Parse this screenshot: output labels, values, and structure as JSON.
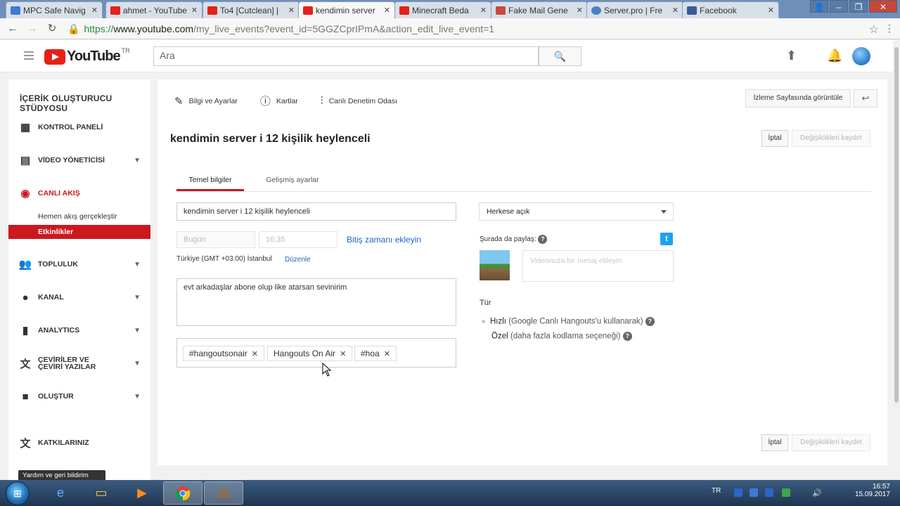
{
  "browser": {
    "tabs": [
      {
        "title": "MPC Safe Navig",
        "color": "#3b7bd4"
      },
      {
        "title": "ahmet - YouTube",
        "color": "#e62117"
      },
      {
        "title": "To4 [Cutclean] |",
        "color": "#e62117"
      },
      {
        "title": "kendimin server",
        "color": "#e62117"
      },
      {
        "title": "Minecraft Beda",
        "color": "#e62117"
      },
      {
        "title": "Fake Mail Gene",
        "color": "#c84a3a"
      },
      {
        "title": "Server.pro | Fre",
        "color": "#4a7fc4"
      },
      {
        "title": "Facebook",
        "color": "#3b5998"
      }
    ],
    "active_tab": 3,
    "url_https": "https://",
    "url_host": "www.youtube.com",
    "url_path": "/my_live_events?event_id=5GGZCprIPmA&action_edit_live_event=1"
  },
  "yt": {
    "logo_text": "YouTube",
    "country": "TR",
    "search_placeholder": "Ara"
  },
  "sidebar": {
    "title": "İÇERİK OLUŞTURUCU STÜDYOSU",
    "items": {
      "dashboard": "KONTROL PANELİ",
      "video_manager": "VİDEO YÖNETİCİSİ",
      "live": "CANLI AKIŞ",
      "live_now": "Hemen akış gerçekleştir",
      "events": "Etkinlikler",
      "community": "TOPLULUK",
      "channel": "KANAL",
      "analytics": "ANALYTICS",
      "translations": "ÇEVİRİLER VE ÇEVİRİ YAZILAR",
      "create": "OLUŞTUR",
      "contributions": "KATKILARINIZ"
    },
    "tooltip": "Yardım ve geri bildirim"
  },
  "main": {
    "toptabs": {
      "info": "Bilgi ve Ayarlar",
      "cards": "Kartlar",
      "control_room": "Canlı Denetim Odası"
    },
    "watch_button": "İzleme Sayfasında görüntüle",
    "event_title": "kendimin server i 12 kişilik heylenceli",
    "cancel": "İptal",
    "save": "Değişiklikleri kaydet",
    "subtabs": {
      "basic": "Temel bilgiler",
      "advanced": "Gelişmiş ayarlar"
    },
    "form": {
      "title_value": "kendimin server i 12 kişilik heylenceli",
      "date_value": "Bugün",
      "time_value": "16:35",
      "add_end_time": "Bitiş zamanı ekleyin",
      "timezone": "Türkiye (GMT +03:00) İstanbul",
      "edit": "Düzenle",
      "description": "evt arkadaşlar  abone olup like atarsan sevinirim",
      "tags": [
        "#hangoutsonair",
        "Hangouts On Air",
        "#hoa"
      ]
    },
    "right": {
      "privacy": "Herkese açık",
      "share_label": "Şurada da paylaş:",
      "message_placeholder": "Videonuza bir mesaj ekleyin",
      "type_label": "Tür",
      "type_fast": "Hızlı",
      "type_fast_note": "(Google Canlı Hangouts'u kullanarak)",
      "type_custom": "Özel",
      "type_custom_note": "(daha fazla kodlama seçeneği)"
    }
  },
  "taskbar": {
    "lang": "TR",
    "time": "16:57",
    "date": "15.09.2017"
  }
}
